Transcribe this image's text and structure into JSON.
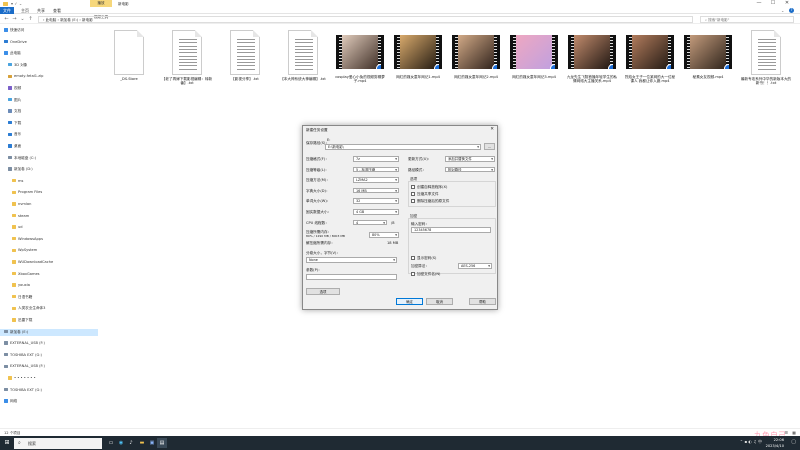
{
  "titlebar": {
    "manage_tab": "播放",
    "app_tools": "视频工具",
    "path": "新电影",
    "min": "—",
    "max": "☐",
    "close": "✕"
  },
  "ribbon": {
    "tabs": [
      "文件",
      "主页",
      "共享",
      "查看"
    ]
  },
  "address": {
    "path": "›  此电脑  ›  新加卷 (E:)  ›  新电影",
    "search_placeholder": "搜索\"新电影\""
  },
  "sidebar": {
    "items": [
      {
        "label": "快速访问",
        "color": "#3b8ee8"
      },
      {
        "label": "OneDrive",
        "color": "#2b7cd3"
      },
      {
        "label": "此电脑",
        "color": "#3b8ee8"
      },
      {
        "label": "3D 对象",
        "color": "#4aa3df"
      },
      {
        "label": "emoty-fetal1.zip",
        "color": "#d7a13a"
      },
      {
        "label": "视频",
        "color": "#7a5fc9"
      },
      {
        "label": "图片",
        "color": "#4aa3df"
      },
      {
        "label": "文档",
        "color": "#6b8bb8"
      },
      {
        "label": "下载",
        "color": "#2b7cd3"
      },
      {
        "label": "音乐",
        "color": "#2b7cd3"
      },
      {
        "label": "桌面",
        "color": "#2b7cd3"
      },
      {
        "label": "本地磁盘 (C:)",
        "color": "#7c8ea3"
      },
      {
        "label": "新加卷 (D:)",
        "color": "#7c8ea3"
      },
      {
        "label": "ms",
        "color": "#f0c24f"
      },
      {
        "label": "Program Files",
        "color": "#f0c24f"
      },
      {
        "label": "nvmlan",
        "color": "#f0c24f"
      },
      {
        "label": "steam",
        "color": "#f0c24f"
      },
      {
        "label": "ud",
        "color": "#f0c24f"
      },
      {
        "label": "WindowsApps",
        "color": "#f0c24f"
      },
      {
        "label": "WpSystem",
        "color": "#f0c24f"
      },
      {
        "label": "WUDownloadCache",
        "color": "#f0c24f"
      },
      {
        "label": "XboxGames",
        "color": "#f0c24f"
      },
      {
        "label": "youxia",
        "color": "#f0c24f"
      },
      {
        "label": "日语书籍",
        "color": "#f0c24f"
      },
      {
        "label": "人类农业生命体3",
        "color": "#f0c24f"
      },
      {
        "label": "迅雷下载",
        "color": "#f0c24f"
      },
      {
        "label": "新加卷 (E:)",
        "color": "#7c8ea3"
      },
      {
        "label": "EXTERNAL_USB (F:)",
        "color": "#7c8ea3"
      },
      {
        "label": "TOSHIBA EXT (G:)",
        "color": "#7c8ea3"
      },
      {
        "label": "EXTERNAL_USB (F:)",
        "color": "#7c8ea3"
      },
      {
        "label": "• • • • • • •",
        "color": "#f0c24f"
      },
      {
        "label": "TOSHIBA EXT (G:)",
        "color": "#7c8ea3"
      },
      {
        "label": "网络",
        "color": "#3b8ee8"
      }
    ]
  },
  "files": [
    {
      "name": "_DS.Store",
      "kind": "blank"
    },
    {
      "name": "【老了再嫁下载影视编辑：转新番】.txt",
      "kind": "doc"
    },
    {
      "name": "【影视分享】.txt",
      "kind": "doc"
    },
    {
      "name": "【本大神系统大神编辑】.txt",
      "kind": "doc"
    },
    {
      "name": "cosplay爱心小兔的视频剪辑萝子.mp4",
      "kind": "video",
      "palette": [
        "#e7d2c2",
        "#3a2a22"
      ]
    },
    {
      "name": "网红的媒女童年网记1.mp4",
      "kind": "video",
      "palette": [
        "#e0b070",
        "#201810"
      ]
    },
    {
      "name": "网红的媒女童年网记2.mp4",
      "kind": "video",
      "palette": [
        "#d9b08c",
        "#2b1e18"
      ]
    },
    {
      "name": "网红的媒女童年网记3.mp4",
      "kind": "video",
      "palette": [
        "#f0a8c0",
        "#bfa0e0"
      ]
    },
    {
      "name": "九龙先生飞翔首播年轻学生的私情网络大主播关系.mp4",
      "kind": "video",
      "palette": [
        "#c89070",
        "#1c1410"
      ]
    },
    {
      "name": "烈焰女王子一位某网的大一位秘课人 我都让你入魔.mp4",
      "kind": "video",
      "palette": [
        "#b88060",
        "#201812"
      ]
    },
    {
      "name": "秘素女友视频.mp4",
      "kind": "video",
      "palette": [
        "#c9a080",
        "#2a2018"
      ]
    },
    {
      "name": "最新专攻系列中华的新版本大的新书！！.txt",
      "kind": "doc"
    }
  ],
  "dialog": {
    "title": "新建任务设置",
    "save_to_label": "保存路径(S)：",
    "drive": "E:",
    "path_value": "E:\\新电影\\",
    "browse": "...",
    "left": [
      {
        "label": "压缩格式(F)：",
        "value": "7z"
      },
      {
        "label": "压缩等级(L)：",
        "value": "5 - 标准压缩"
      },
      {
        "label": "压缩方法(M)：",
        "value": "LZMA2"
      },
      {
        "label": "字典大小(D)：",
        "value": "16 MB"
      },
      {
        "label": "单词大小(W)：",
        "value": "32"
      },
      {
        "label": "固实数据大小：",
        "value": "4 GB"
      },
      {
        "label": "CPU 线程数：",
        "value": "4"
      }
    ],
    "cpu_total": "/8",
    "memory_label": "压缩所需内存：",
    "memory_sub": "80% / 1290 MB / 8003 MB",
    "memory_value": "80%",
    "decompress_label": "解压缩所需内存：",
    "decompress_value": "18 MB",
    "split_label": "分卷大小，字节(V)：",
    "split_value": "None",
    "params_label": "参数(P)：",
    "params_value": "",
    "options_button": "选项",
    "right": [
      {
        "label": "更新方式(U)：",
        "value": "添加并替换文件"
      },
      {
        "label": "路径模式：",
        "value": "相对路径"
      }
    ],
    "options_title": "选项",
    "options": [
      "创建自释放程序(X)",
      "压缩共享文件",
      "删除压缩后的原文件"
    ],
    "encrypt_title": "加密",
    "password_label": "输入密码：",
    "password_value": "12345678",
    "show_password": "显示密码(S)",
    "encrypt_method_label": "加密算法：",
    "encrypt_method_value": "AES-256",
    "encrypt_names": "加密文件名(N)",
    "ok": "确定",
    "cancel": "取消",
    "help": "帮助"
  },
  "status": {
    "count": "12 个项目"
  },
  "taskbar": {
    "search": "搜索",
    "time": "22:06",
    "date": "2023/4/10"
  },
  "watermark": "九鱼自己"
}
